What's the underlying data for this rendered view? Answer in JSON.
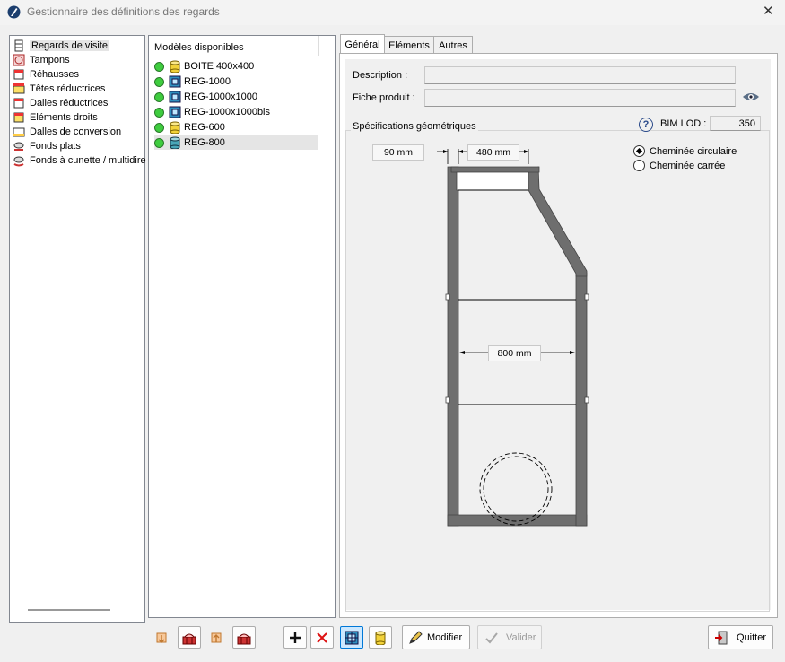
{
  "window": {
    "title": "Gestionnaire des définitions des regards",
    "close_glyph": "✕"
  },
  "tree": {
    "items": [
      {
        "label": "Regards de visite",
        "icon": "manhole-icon",
        "selected": true
      },
      {
        "label": "Tampons",
        "icon": "cover-icon"
      },
      {
        "label": "Réhausses",
        "icon": "riser-icon"
      },
      {
        "label": "Têtes réductrices",
        "icon": "reducer-head-icon"
      },
      {
        "label": "Dalles réductrices",
        "icon": "reducer-slab-icon"
      },
      {
        "label": "Eléments droits",
        "icon": "straight-element-icon"
      },
      {
        "label": "Dalles de conversion",
        "icon": "conversion-slab-icon"
      },
      {
        "label": "Fonds plats",
        "icon": "flat-bottom-icon"
      },
      {
        "label": "Fonds à cunette / multidire",
        "icon": "channel-bottom-icon"
      }
    ]
  },
  "models": {
    "header": "Modèles disponibles",
    "items": [
      {
        "label": "BOITE 400x400",
        "icon": "yellow-cylinder-icon"
      },
      {
        "label": "REG-1000",
        "icon": "square-grid-icon"
      },
      {
        "label": "REG-1000x1000",
        "icon": "square-grid-icon"
      },
      {
        "label": "REG-1000x1000bis",
        "icon": "square-grid-icon"
      },
      {
        "label": "REG-600",
        "icon": "yellow-cylinder-icon"
      },
      {
        "label": "REG-800",
        "icon": "teal-cylinder-icon",
        "selected": true
      }
    ]
  },
  "tabs": [
    "Général",
    "Eléments",
    "Autres"
  ],
  "general": {
    "description_label": "Description :",
    "description_value": "",
    "fiche_label": "Fiche produit :",
    "fiche_value": "",
    "specs_label": "Spécifications géométriques",
    "bim_label": "BIM LOD :",
    "bim_value": "350",
    "dim_offset": "90 mm",
    "dim_top": "480 mm",
    "dim_inner": "800 mm",
    "radio_circular": "Cheminée circulaire",
    "radio_square": "Cheminée carrée",
    "circular_checked": true
  },
  "buttons": {
    "modify": "Modifier",
    "validate": "Valider",
    "quit": "Quitter"
  },
  "colors": {
    "selection": "#e5e5e5",
    "active_tool": "#cce8ff",
    "wall": "#707070"
  }
}
